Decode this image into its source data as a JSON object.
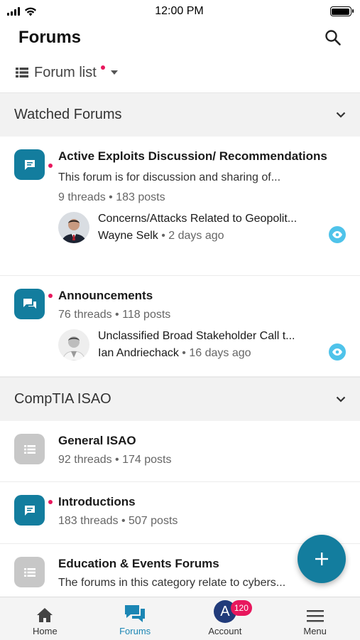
{
  "status_bar": {
    "time": "12:00 PM"
  },
  "header": {
    "title": "Forums",
    "search_icon": "search-icon"
  },
  "filter": {
    "label": "Forum list",
    "has_indicator": true
  },
  "sections": {
    "watched": {
      "title": "Watched Forums",
      "forums": [
        {
          "title": "Active Exploits Discussion/ Recommendations",
          "unread": true,
          "icon": "chat-bubble-icon",
          "description": "This forum is for discussion and sharing of...",
          "stats": "9 threads • 183 posts",
          "last_post_title": "Concerns/Attacks Related to Geopolit...",
          "last_post_author": "Wayne Selk",
          "last_post_time": "2 days ago",
          "watched": true
        },
        {
          "title": "Announcements",
          "unread": true,
          "icon": "chat-bubbles-icon",
          "stats": "76 threads • 118 posts",
          "last_post_title": "Unclassified Broad Stakeholder Call t...",
          "last_post_author": "Ian Andriechack",
          "last_post_time": "16 days ago",
          "watched": true
        }
      ]
    },
    "comptia": {
      "title": "CompTIA ISAO",
      "forums": [
        {
          "title": "General ISAO",
          "unread": false,
          "icon": "list-icon",
          "stats": "92 threads • 174 posts"
        },
        {
          "title": "Introductions",
          "unread": true,
          "icon": "chat-bubble-icon",
          "stats": "183 threads • 507 posts"
        },
        {
          "title": "Education & Events Forums",
          "unread": false,
          "icon": "list-icon",
          "description": "The forums in this category relate to cybers..."
        }
      ]
    }
  },
  "fab": {
    "icon": "plus-icon"
  },
  "bottom_nav": {
    "items": [
      {
        "label": "Home",
        "icon": "home-icon"
      },
      {
        "label": "Forums",
        "icon": "forums-icon",
        "active": true
      },
      {
        "label": "Account",
        "avatar_letter": "A",
        "badge": "120"
      },
      {
        "label": "Menu",
        "icon": "hamburger-icon"
      }
    ]
  },
  "colors": {
    "accent": "#137d9e",
    "unread_dot": "#e8175d",
    "watch_badge": "#4fc3ea",
    "account_avatar": "#213b7a"
  }
}
